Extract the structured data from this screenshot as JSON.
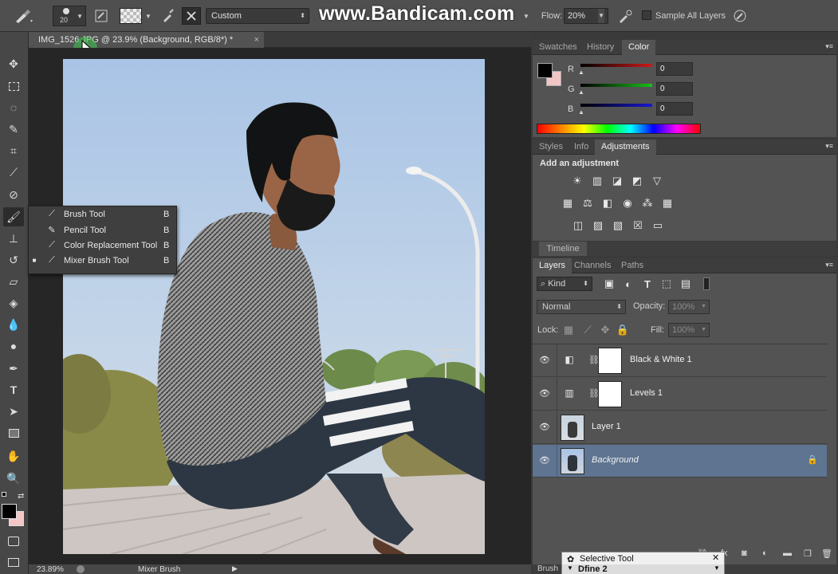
{
  "options_bar": {
    "brush_size": "20",
    "preset_label": "Custom",
    "watermark": "www.Bandicam.com",
    "flow_label": "Flow:",
    "flow_value": "20%",
    "sample_all_label": "Sample All Layers"
  },
  "document": {
    "tab_title": "IMG_1526.JPG @ 23.9% (Background, RGB/8*) *",
    "close": "×",
    "zoom": "23.89%",
    "status_text": "Mixer Brush"
  },
  "tool_flyout": {
    "items": [
      {
        "label": "Brush Tool",
        "key": "B",
        "icon": "brush-icon",
        "selected": false
      },
      {
        "label": "Pencil Tool",
        "key": "B",
        "icon": "pencil-icon",
        "selected": false
      },
      {
        "label": "Color Replacement Tool",
        "key": "B",
        "icon": "color-replacement-icon",
        "selected": false
      },
      {
        "label": "Mixer Brush Tool",
        "key": "B",
        "icon": "mixer-brush-icon",
        "selected": true
      }
    ]
  },
  "color_panel": {
    "tabs": [
      "Swatches",
      "History",
      "Color"
    ],
    "active_tab": "Color",
    "channels": [
      {
        "label": "R",
        "value": "0",
        "color": "#d01818"
      },
      {
        "label": "G",
        "value": "0",
        "color": "#18c018"
      },
      {
        "label": "B",
        "value": "0",
        "color": "#1818d0"
      }
    ],
    "foreground": "#000000",
    "background": "#f3c6c6"
  },
  "adjustments_panel": {
    "tabs": [
      "Styles",
      "Info",
      "Adjustments"
    ],
    "active_tab": "Adjustments",
    "heading": "Add an adjustment"
  },
  "timeline_panel": {
    "label": "Timeline"
  },
  "layers_panel": {
    "tabs": [
      "Layers",
      "Channels",
      "Paths"
    ],
    "active_tab": "Layers",
    "filter_kind": "Kind",
    "blend_mode": "Normal",
    "opacity_label": "Opacity:",
    "opacity_value": "100%",
    "lock_label": "Lock:",
    "fill_label": "Fill:",
    "fill_value": "100%",
    "layers": [
      {
        "name": "Black & White 1",
        "type": "adjustment",
        "icon": "black-white-icon",
        "selected": false
      },
      {
        "name": "Levels 1",
        "type": "adjustment",
        "icon": "levels-icon",
        "selected": false
      },
      {
        "name": "Layer 1",
        "type": "pixel",
        "selected": false
      },
      {
        "name": "Background",
        "type": "pixel",
        "selected": true,
        "locked": true
      }
    ],
    "bottom_tab": "Brush"
  },
  "tooltip_popup": {
    "title": "Selective Tool",
    "subtitle": "Dfine 2"
  }
}
